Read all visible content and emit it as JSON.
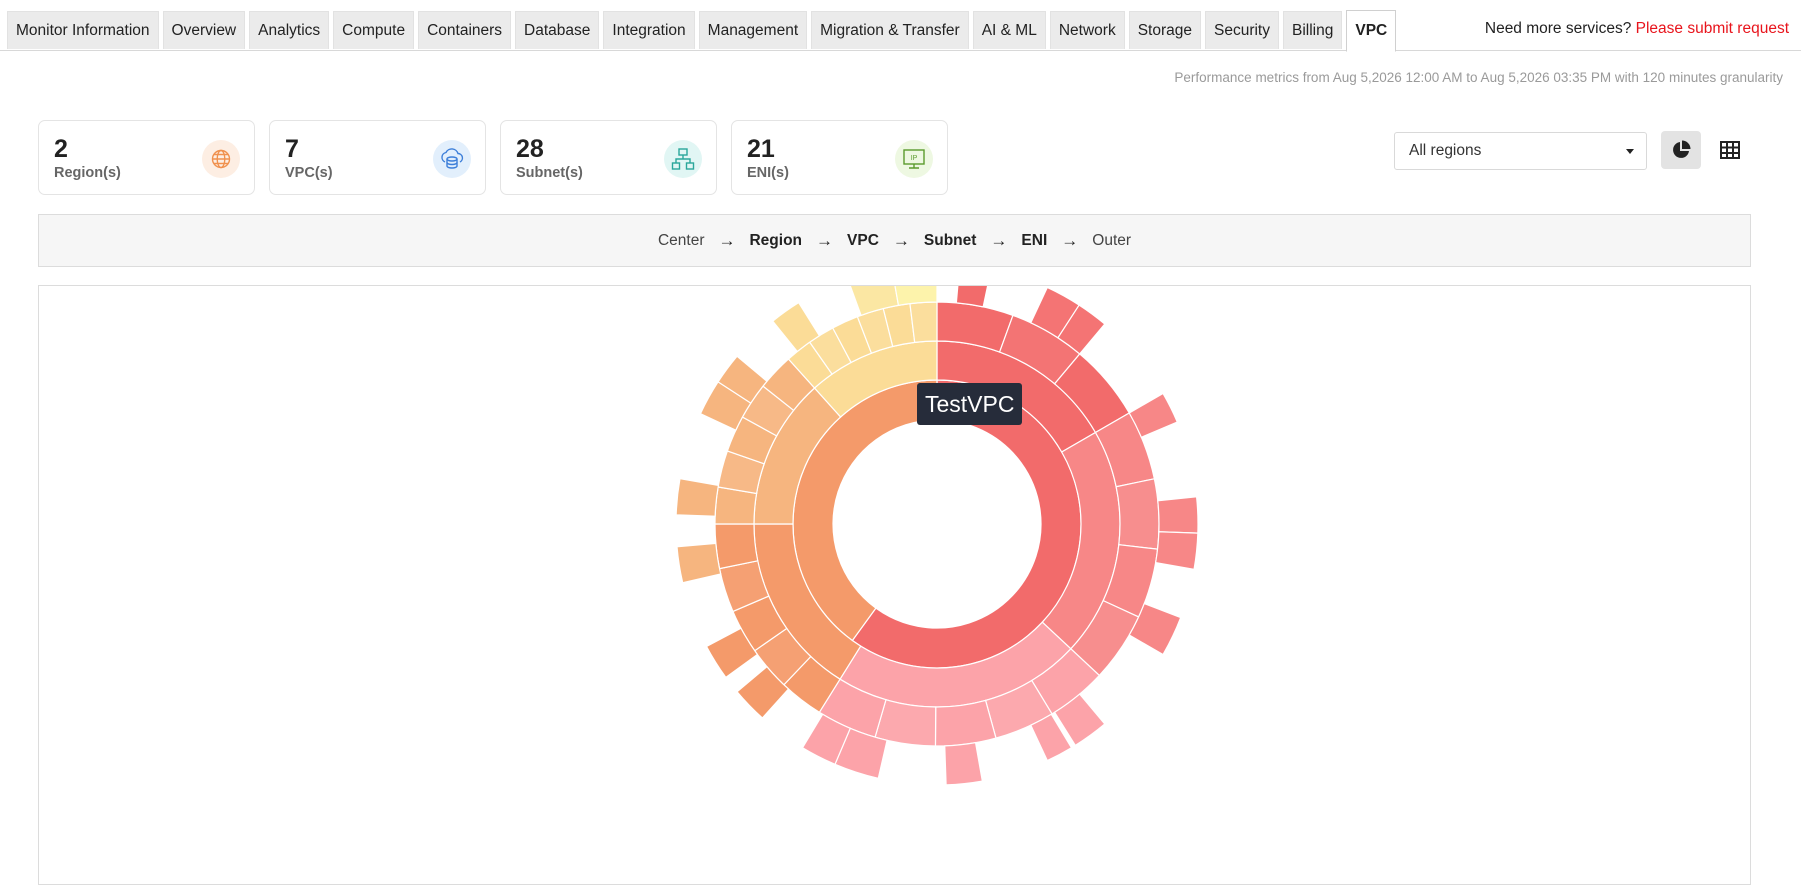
{
  "tabs": [
    {
      "label": "Monitor Information",
      "active": false
    },
    {
      "label": "Overview",
      "active": false
    },
    {
      "label": "Analytics",
      "active": false
    },
    {
      "label": "Compute",
      "active": false
    },
    {
      "label": "Containers",
      "active": false
    },
    {
      "label": "Database",
      "active": false
    },
    {
      "label": "Integration",
      "active": false
    },
    {
      "label": "Management",
      "active": false
    },
    {
      "label": "Migration & Transfer",
      "active": false
    },
    {
      "label": "AI & ML",
      "active": false
    },
    {
      "label": "Network",
      "active": false
    },
    {
      "label": "Storage",
      "active": false
    },
    {
      "label": "Security",
      "active": false
    },
    {
      "label": "Billing",
      "active": false
    },
    {
      "label": "VPC",
      "active": true
    }
  ],
  "header": {
    "need_text": "Need more services?",
    "request_link": "Please submit request"
  },
  "performance_text": "Performance metrics from Aug 5,2026 12:00 AM to Aug 5,2026 03:35 PM with 120 minutes granularity",
  "summary_cards": [
    {
      "value": "2",
      "label": "Region(s)",
      "icon": "globe-icon",
      "icon_bg": "#fdeee3",
      "icon_color": "#f0914e"
    },
    {
      "value": "7",
      "label": "VPC(s)",
      "icon": "cloud-database-icon",
      "icon_bg": "#e2effc",
      "icon_color": "#3d7fd9"
    },
    {
      "value": "28",
      "label": "Subnet(s)",
      "icon": "network-tree-icon",
      "icon_bg": "#e1f6f4",
      "icon_color": "#2aa79b"
    },
    {
      "value": "21",
      "label": "ENI(s)",
      "icon": "ip-monitor-icon",
      "icon_bg": "#eef8e2",
      "icon_color": "#5b9b2d"
    }
  ],
  "region_filter": {
    "selected": "All regions"
  },
  "view_buttons": [
    {
      "name": "pie-chart-icon",
      "active": true
    },
    {
      "name": "table-grid-icon",
      "active": false
    }
  ],
  "breadcrumb": [
    {
      "label": "Center",
      "bold": false
    },
    {
      "label": "Region",
      "bold": true
    },
    {
      "label": "VPC",
      "bold": true
    },
    {
      "label": "Subnet",
      "bold": true
    },
    {
      "label": "ENI",
      "bold": true
    },
    {
      "label": "Outer",
      "bold": false
    }
  ],
  "tooltip": "TestVPC",
  "chart_data": {
    "type": "sunburst",
    "levels": [
      "Region",
      "VPC",
      "Subnet",
      "ENI"
    ],
    "regions": [
      {
        "share": 0.6,
        "color": "#f26b6b",
        "vpc_color": "#f78f8f",
        "subnet_color": "#fa9d9d",
        "eni_color": "#f78888",
        "vpcs": [
          0.19,
          0.205,
          0.195
        ],
        "subnets": 12,
        "enis": 9
      },
      {
        "share": 0.4,
        "color": "#f49a6a",
        "vpc_color": "#f6b57f",
        "subnet_color": "#f8c98c",
        "eni_color": "#f6b97a",
        "vpcs": [
          0.13,
          0.14,
          0.13
        ],
        "subnets": 16,
        "enis": 12
      }
    ],
    "colors": {
      "region_a": "#f26b6b",
      "region_b": "#f49a6a",
      "vpc_pink": "#fca3a9",
      "vpc_yellow": "#fbe7a3"
    }
  }
}
